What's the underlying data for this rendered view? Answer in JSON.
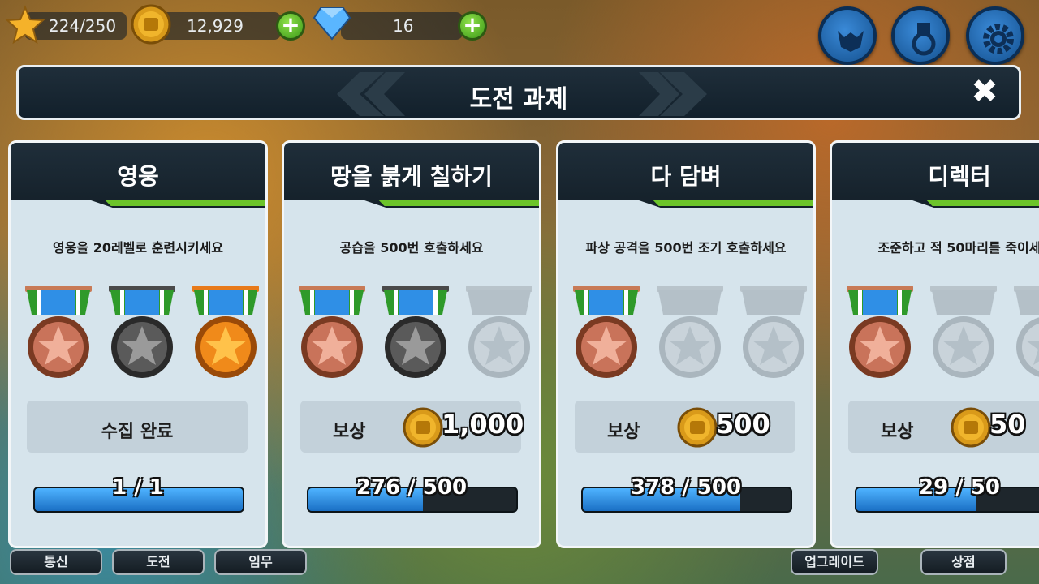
{
  "topbar": {
    "xp": "224/250",
    "gold": "12,929",
    "gems": "16",
    "icons": [
      "star-icon",
      "gold-coin-icon",
      "gem-icon",
      "plus-icon",
      "creature-badge-icon",
      "medal-icon",
      "gear-icon"
    ]
  },
  "header": {
    "title": "도전 과제",
    "close_label": "✖"
  },
  "cards": [
    {
      "title": "영웅",
      "description": "영웅을 20레벨로 훈련시키세요",
      "medals": [
        "bronze",
        "silver",
        "gold"
      ],
      "reward_done": "수집 완료",
      "progress_text": "1 / 1",
      "progress": 1.0
    },
    {
      "title": "땅을 붉게 칠하기",
      "description": "공습을 500번 호출하세요",
      "medals": [
        "bronze",
        "silver",
        "locked"
      ],
      "reward_label": "보상",
      "reward_amount": "1,000",
      "progress_text": "276 / 500",
      "progress": 0.552
    },
    {
      "title": "다 담벼",
      "description": "파상 공격을 500번 조기 호출하세요",
      "medals": [
        "bronze",
        "locked",
        "locked"
      ],
      "reward_label": "보상",
      "reward_amount": "500",
      "progress_text": "378 / 500",
      "progress": 0.756
    },
    {
      "title": "디렉터",
      "description": "조준하고 적 50마리를 죽이세",
      "medals": [
        "bronze",
        "locked",
        "locked"
      ],
      "reward_label": "보상",
      "reward_amount": "50",
      "progress_text": "29 / 50",
      "progress": 0.58
    }
  ],
  "bottom_nav": {
    "left": [
      "통신",
      "도전",
      "임무"
    ],
    "upgrade": "업그레이드",
    "shop": "상점"
  },
  "colors": {
    "accent_green": "#6cc42a",
    "progress_blue": "#2f8fe6",
    "card_bg": "#d6e4ec",
    "header_bg": "#1a2833"
  }
}
